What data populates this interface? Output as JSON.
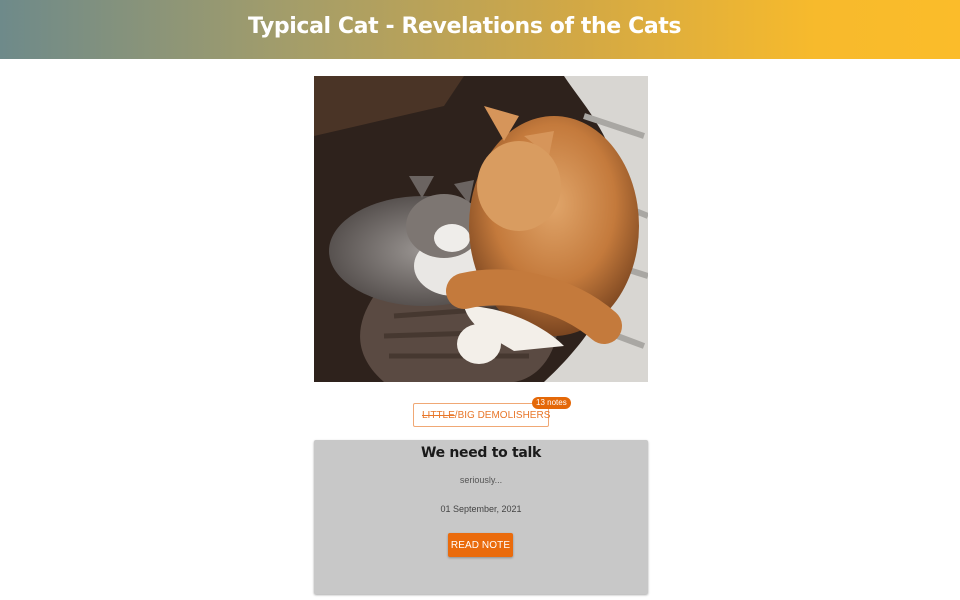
{
  "header": {
    "title": "Typical Cat - Revelations of the Cats"
  },
  "photo": {
    "subject": "two cats sleeping"
  },
  "tag": {
    "struck_text": "LITTLE",
    "text": "/BIG DEMOLISHERS",
    "icon": "book-icon",
    "notes_badge": "13 notes"
  },
  "card": {
    "title": "We need to talk",
    "subtitle": "seriously...",
    "date": "01 September, 2021",
    "button_label": "READ NOTE"
  },
  "colors": {
    "accent": "#ea6b0c",
    "card_bg": "#c8c8c8",
    "header_start": "#6e8a8a",
    "header_end": "#fbbc2a"
  }
}
